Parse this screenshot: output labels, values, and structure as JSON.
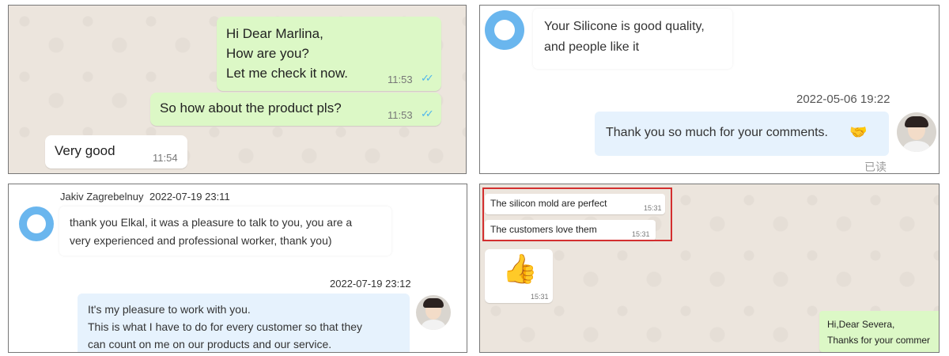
{
  "panel1": {
    "messages": [
      {
        "lines": [
          "Hi Dear Marlina,",
          "How are you?",
          "Let me check it now."
        ],
        "time": "11:53"
      },
      {
        "text": "So how about the product pls?",
        "time": "11:53"
      },
      {
        "text": "Very good",
        "time": "11:54"
      }
    ]
  },
  "panel2": {
    "incoming": {
      "lines": [
        "Your Silicone is good quality,",
        "and people like it"
      ]
    },
    "timestamp": "2022-05-06 19:22",
    "outgoing": {
      "text": "Thank you so much for your comments.",
      "emoji": "🤝"
    },
    "read_status": "已读"
  },
  "panel3": {
    "sender": "Jakiv Zagrebelnuy",
    "incoming_time": "2022-07-19 23:11",
    "incoming": {
      "lines": [
        "thank you Elkal, it was a pleasure to talk to you, you are a",
        "very experienced and professional worker, thank you)"
      ]
    },
    "outgoing_time": "2022-07-19 23:12",
    "outgoing": {
      "lines": [
        "It's my pleasure to work with you.",
        "This is what I have to do for every customer so that they",
        "can count on me on our products and our service."
      ]
    }
  },
  "panel4": {
    "messages": [
      {
        "text": "The silicon mold are perfect",
        "time": "15:31"
      },
      {
        "text": "The customers love them",
        "time": "15:31"
      },
      {
        "emoji": "👍",
        "time": "15:31"
      }
    ],
    "outgoing": {
      "lines": [
        "Hi,Dear Severa,",
        "Thanks for your commer"
      ]
    },
    "highlight_color": "#d32f2f"
  },
  "colors": {
    "wa_out": "#dcf8c6",
    "wa_bg": "#ece5dd",
    "read_ticks": "#4fb6ec",
    "bot_avatar": "#6ab6ee",
    "chat_out": "#e6f2fd"
  }
}
